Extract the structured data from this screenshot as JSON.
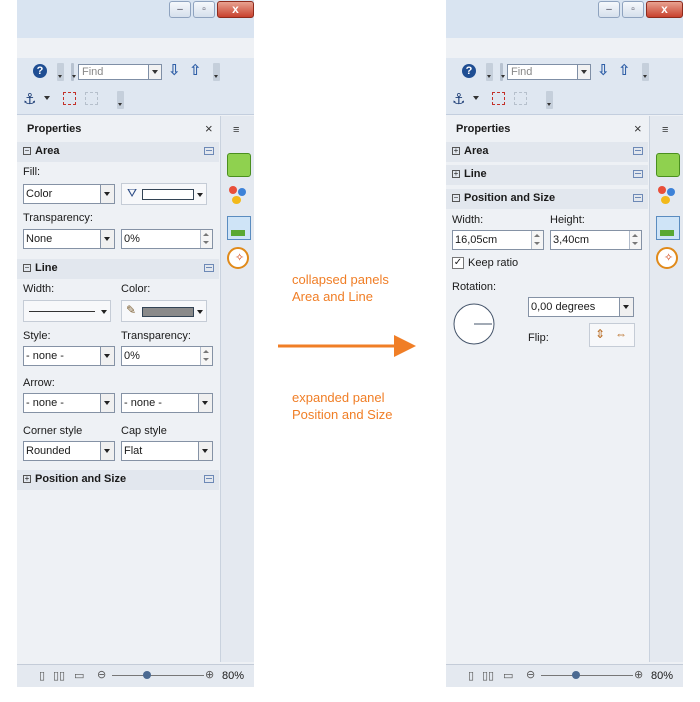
{
  "colors": {
    "accent_orange": "#f07e26",
    "frame_bg": "#eef1f5"
  },
  "annotations": {
    "collapsed_line1": "collapsed panels",
    "collapsed_line2": "Area and Line",
    "expanded_line1": "expanded panel",
    "expanded_line2": "Position and Size"
  },
  "left": {
    "toolbar": {
      "find_placeholder": "Find"
    },
    "sidebar": {
      "title": "Properties",
      "close": "×"
    },
    "area": {
      "title": "Area",
      "fill_label": "Fill:",
      "fill_value": "Color",
      "transparency_label": "Transparency:",
      "transparency_value": "None",
      "transparency_percent": "0%"
    },
    "line": {
      "title": "Line",
      "width_label": "Width:",
      "color_label": "Color:",
      "style_label": "Style:",
      "style_value": "- none -",
      "transparency_label": "Transparency:",
      "transparency_percent": "0%",
      "arrow_label": "Arrow:",
      "arrow_start": "- none -",
      "arrow_end": "- none -",
      "corner_label": "Corner style",
      "corner_value": "Rounded",
      "cap_label": "Cap style",
      "cap_value": "Flat"
    },
    "position": {
      "title": "Position and Size"
    },
    "status": {
      "zoom": "80%"
    }
  },
  "right": {
    "toolbar": {
      "find_placeholder": "Find"
    },
    "sidebar": {
      "title": "Properties",
      "close": "×"
    },
    "area": {
      "title": "Area"
    },
    "line": {
      "title": "Line"
    },
    "position": {
      "title": "Position and Size",
      "width_label": "Width:",
      "width_value": "16,05cm",
      "height_label": "Height:",
      "height_value": "3,40cm",
      "keep_ratio_label": "Keep ratio",
      "keep_ratio_checked": true,
      "rotation_label": "Rotation:",
      "rotation_value": "0,00 degrees",
      "flip_label": "Flip:"
    },
    "status": {
      "zoom": "80%"
    }
  }
}
